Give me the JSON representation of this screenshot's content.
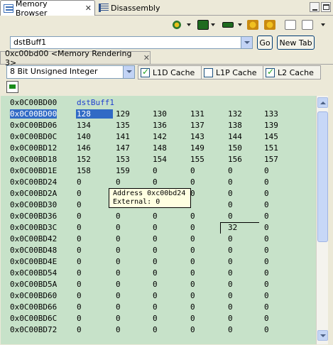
{
  "tabs": [
    {
      "label": "Memory Browser",
      "close": "✕",
      "active": true
    },
    {
      "label": "Disassembly",
      "active": false
    }
  ],
  "expression": {
    "value": "dstBuff1",
    "go_label": "Go",
    "new_tab_label": "New Tab"
  },
  "rendering_tab": {
    "label": "0xc00bd00 <Memory Rendering 3>",
    "close": "✕"
  },
  "format": {
    "selected": "8 Bit Unsigned Integer",
    "cache": [
      {
        "label": "L1D Cache",
        "checked": true
      },
      {
        "label": "L1P Cache",
        "checked": false
      },
      {
        "label": "L2 Cache",
        "checked": true
      }
    ]
  },
  "memory": {
    "header": {
      "address": "0x0C00BD00",
      "label": "dstBuff1"
    },
    "rows": [
      {
        "address": "0x0C00BD00",
        "values": [
          "128",
          "129",
          "130",
          "131",
          "132",
          "133"
        ]
      },
      {
        "address": "0x0C00BD06",
        "values": [
          "134",
          "135",
          "136",
          "137",
          "138",
          "139"
        ]
      },
      {
        "address": "0x0C00BD0C",
        "values": [
          "140",
          "141",
          "142",
          "143",
          "144",
          "145"
        ]
      },
      {
        "address": "0x0C00BD12",
        "values": [
          "146",
          "147",
          "148",
          "149",
          "150",
          "151"
        ]
      },
      {
        "address": "0x0C00BD18",
        "values": [
          "152",
          "153",
          "154",
          "155",
          "156",
          "157"
        ]
      },
      {
        "address": "0x0C00BD1E",
        "values": [
          "158",
          "159",
          "0",
          "0",
          "0",
          "0"
        ]
      },
      {
        "address": "0x0C00BD24",
        "values": [
          "0",
          "0",
          "0",
          "0",
          "0",
          "0"
        ]
      },
      {
        "address": "0x0C00BD2A",
        "values": [
          "0",
          "",
          "",
          "0",
          "0",
          "0"
        ]
      },
      {
        "address": "0x0C00BD30",
        "values": [
          "0",
          "",
          "",
          "",
          "0",
          "0"
        ]
      },
      {
        "address": "0x0C00BD36",
        "values": [
          "0",
          "0",
          "0",
          "0",
          "0",
          "0"
        ]
      },
      {
        "address": "0x0C00BD3C",
        "values": [
          "0",
          "0",
          "0",
          "0",
          "32",
          "0"
        ]
      },
      {
        "address": "0x0C00BD42",
        "values": [
          "0",
          "0",
          "0",
          "0",
          "0",
          "0"
        ]
      },
      {
        "address": "0x0C00BD48",
        "values": [
          "0",
          "0",
          "0",
          "0",
          "0",
          "0"
        ]
      },
      {
        "address": "0x0C00BD4E",
        "values": [
          "0",
          "0",
          "0",
          "0",
          "0",
          "0"
        ]
      },
      {
        "address": "0x0C00BD54",
        "values": [
          "0",
          "0",
          "0",
          "0",
          "0",
          "0"
        ]
      },
      {
        "address": "0x0C00BD5A",
        "values": [
          "0",
          "0",
          "0",
          "0",
          "0",
          "0"
        ]
      },
      {
        "address": "0x0C00BD60",
        "values": [
          "0",
          "0",
          "0",
          "0",
          "0",
          "0"
        ]
      },
      {
        "address": "0x0C00BD66",
        "values": [
          "0",
          "0",
          "0",
          "0",
          "0",
          "0"
        ]
      },
      {
        "address": "0x0C00BD6C",
        "values": [
          "0",
          "0",
          "0",
          "0",
          "0",
          "0"
        ]
      },
      {
        "address": "0x0C00BD72",
        "values": [
          "0",
          "0",
          "0",
          "0",
          "0",
          "0"
        ]
      }
    ]
  },
  "tooltip": {
    "line1": "Address 0xc00bd24",
    "line2": "External: 0"
  },
  "colors": {
    "grid_bg": "#c7e2c9",
    "selection": "#316ac5",
    "label": "#1f3fcf"
  }
}
